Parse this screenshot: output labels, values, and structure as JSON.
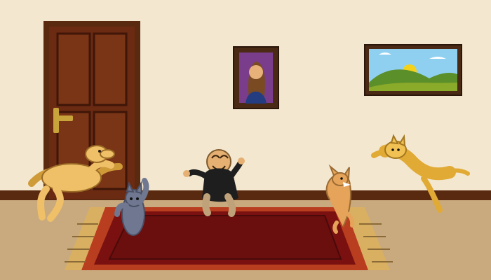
{
  "scene": {
    "colors": {
      "wall": "#f3e7cf",
      "floor": "#c9a97e",
      "baseboard": "#5a2a10",
      "door": "#6b2a12",
      "door_panel": "#7a3416",
      "door_handle": "#c8a43a",
      "rug": "#7a1010",
      "rug_border": "#b93d1f",
      "rug_fringe": "#d9b062",
      "frame": "#4a2a14",
      "portrait_bg": "#7a3d8c",
      "landscape_sky": "#8fd0f0",
      "landscape_hill": "#5b8f2a",
      "sun": "#f4d21a",
      "dog": "#efc068",
      "gray_cat": "#6f7890",
      "orange_cat": "#f1c154",
      "chihuahua": "#e6a35a",
      "kid_shirt": "#1e1e1e",
      "kid_skin": "#e5b071",
      "kid_pants": "#bfa27a"
    },
    "objects": [
      {
        "name": "door",
        "icon": "door-icon"
      },
      {
        "name": "portrait",
        "icon": "portrait-frame-icon"
      },
      {
        "name": "landscape",
        "icon": "landscape-painting-icon"
      },
      {
        "name": "rug",
        "icon": "rug-icon"
      },
      {
        "name": "jumping-dog",
        "icon": "dog-icon"
      },
      {
        "name": "gray-cat",
        "icon": "cat-icon"
      },
      {
        "name": "dancing-kid",
        "icon": "child-icon"
      },
      {
        "name": "chihuahua",
        "icon": "small-dog-icon"
      },
      {
        "name": "leaping-cat",
        "icon": "cat-icon"
      }
    ]
  }
}
